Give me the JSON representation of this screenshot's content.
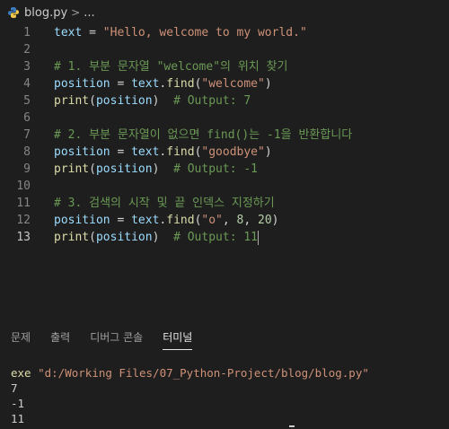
{
  "breadcrumb": {
    "file": "blog.py",
    "sep": ">",
    "more": "..."
  },
  "editor": {
    "lines": [
      {
        "num": "1",
        "tokens": [
          {
            "t": "text",
            "c": "v"
          },
          {
            "t": " = ",
            "c": "p"
          },
          {
            "t": "\"Hello, welcome to my world.\"",
            "c": "s"
          }
        ]
      },
      {
        "num": "2",
        "tokens": []
      },
      {
        "num": "3",
        "tokens": [
          {
            "t": "# 1. 부분 문자열 \"welcome\"의 위치 찾기",
            "c": "c"
          }
        ]
      },
      {
        "num": "4",
        "tokens": [
          {
            "t": "position",
            "c": "v"
          },
          {
            "t": " = ",
            "c": "p"
          },
          {
            "t": "text",
            "c": "v"
          },
          {
            "t": ".",
            "c": "p"
          },
          {
            "t": "find",
            "c": "f"
          },
          {
            "t": "(",
            "c": "p"
          },
          {
            "t": "\"welcome\"",
            "c": "s"
          },
          {
            "t": ")",
            "c": "p"
          }
        ]
      },
      {
        "num": "5",
        "tokens": [
          {
            "t": "print",
            "c": "f"
          },
          {
            "t": "(",
            "c": "p"
          },
          {
            "t": "position",
            "c": "v"
          },
          {
            "t": ")",
            "c": "p"
          },
          {
            "t": "  # Output: 7",
            "c": "c"
          }
        ]
      },
      {
        "num": "6",
        "tokens": []
      },
      {
        "num": "7",
        "tokens": [
          {
            "t": "# 2. 부분 문자열이 없으면 find()는 -1을 반환합니다",
            "c": "c"
          }
        ]
      },
      {
        "num": "8",
        "tokens": [
          {
            "t": "position",
            "c": "v"
          },
          {
            "t": " = ",
            "c": "p"
          },
          {
            "t": "text",
            "c": "v"
          },
          {
            "t": ".",
            "c": "p"
          },
          {
            "t": "find",
            "c": "f"
          },
          {
            "t": "(",
            "c": "p"
          },
          {
            "t": "\"goodbye\"",
            "c": "s"
          },
          {
            "t": ")",
            "c": "p"
          }
        ]
      },
      {
        "num": "9",
        "tokens": [
          {
            "t": "print",
            "c": "f"
          },
          {
            "t": "(",
            "c": "p"
          },
          {
            "t": "position",
            "c": "v"
          },
          {
            "t": ")",
            "c": "p"
          },
          {
            "t": "  # Output: -1",
            "c": "c"
          }
        ]
      },
      {
        "num": "10",
        "tokens": []
      },
      {
        "num": "11",
        "tokens": [
          {
            "t": "# 3. 검색의 시작 및 끝 인덱스 지정하기",
            "c": "c"
          }
        ]
      },
      {
        "num": "12",
        "tokens": [
          {
            "t": "position",
            "c": "v"
          },
          {
            "t": " = ",
            "c": "p"
          },
          {
            "t": "text",
            "c": "v"
          },
          {
            "t": ".",
            "c": "p"
          },
          {
            "t": "find",
            "c": "f"
          },
          {
            "t": "(",
            "c": "p"
          },
          {
            "t": "\"o\"",
            "c": "s"
          },
          {
            "t": ", ",
            "c": "p"
          },
          {
            "t": "8",
            "c": "n"
          },
          {
            "t": ", ",
            "c": "p"
          },
          {
            "t": "20",
            "c": "n"
          },
          {
            "t": ")",
            "c": "p"
          }
        ]
      },
      {
        "num": "13",
        "active": true,
        "tokens": [
          {
            "t": "print",
            "c": "f"
          },
          {
            "t": "(",
            "c": "p"
          },
          {
            "t": "position",
            "c": "v"
          },
          {
            "t": ")",
            "c": "p"
          },
          {
            "t": "  # Output: 11",
            "c": "c"
          }
        ]
      }
    ]
  },
  "panel": {
    "tabs": [
      {
        "label": "문제",
        "active": false
      },
      {
        "label": "출력",
        "active": false
      },
      {
        "label": "디버그 콘솔",
        "active": false
      },
      {
        "label": "터미널",
        "active": true
      }
    ]
  },
  "terminal": {
    "command_exe": "exe",
    "command_path": "\"d:/Working Files/07_Python-Project/blog/blog.py\"",
    "output": [
      "7",
      "-1",
      "11"
    ]
  },
  "colors": {
    "background": "#1e1e1e",
    "variable": "#9cdcfe",
    "string": "#ce9178",
    "function": "#dcdcaa",
    "comment": "#6a9955",
    "number": "#b5cea8"
  },
  "icons": {
    "file": "python-file-icon"
  }
}
